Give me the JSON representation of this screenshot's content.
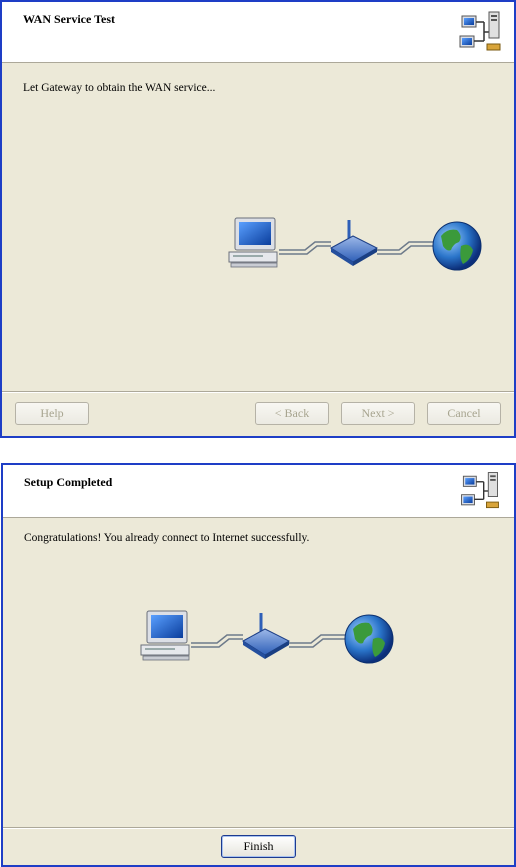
{
  "dialog1": {
    "title": "WAN Service Test",
    "message": "Let Gateway to obtain the WAN service...",
    "buttons": {
      "help": "Help",
      "back": "< Back",
      "next": "Next >",
      "cancel": "Cancel"
    },
    "icons": [
      "network-wizard-icon",
      "computer-icon",
      "router-icon",
      "globe-icon"
    ]
  },
  "dialog2": {
    "title": "Setup Completed",
    "message": "Congratulations! You already connect to Internet successfully.",
    "buttons": {
      "finish": "Finish"
    },
    "icons": [
      "network-wizard-icon",
      "computer-icon",
      "router-icon",
      "globe-icon"
    ]
  },
  "colors": {
    "window_border": "#1e3ec6",
    "dialog_background": "#ece9d8",
    "header_background": "#ffffff"
  }
}
